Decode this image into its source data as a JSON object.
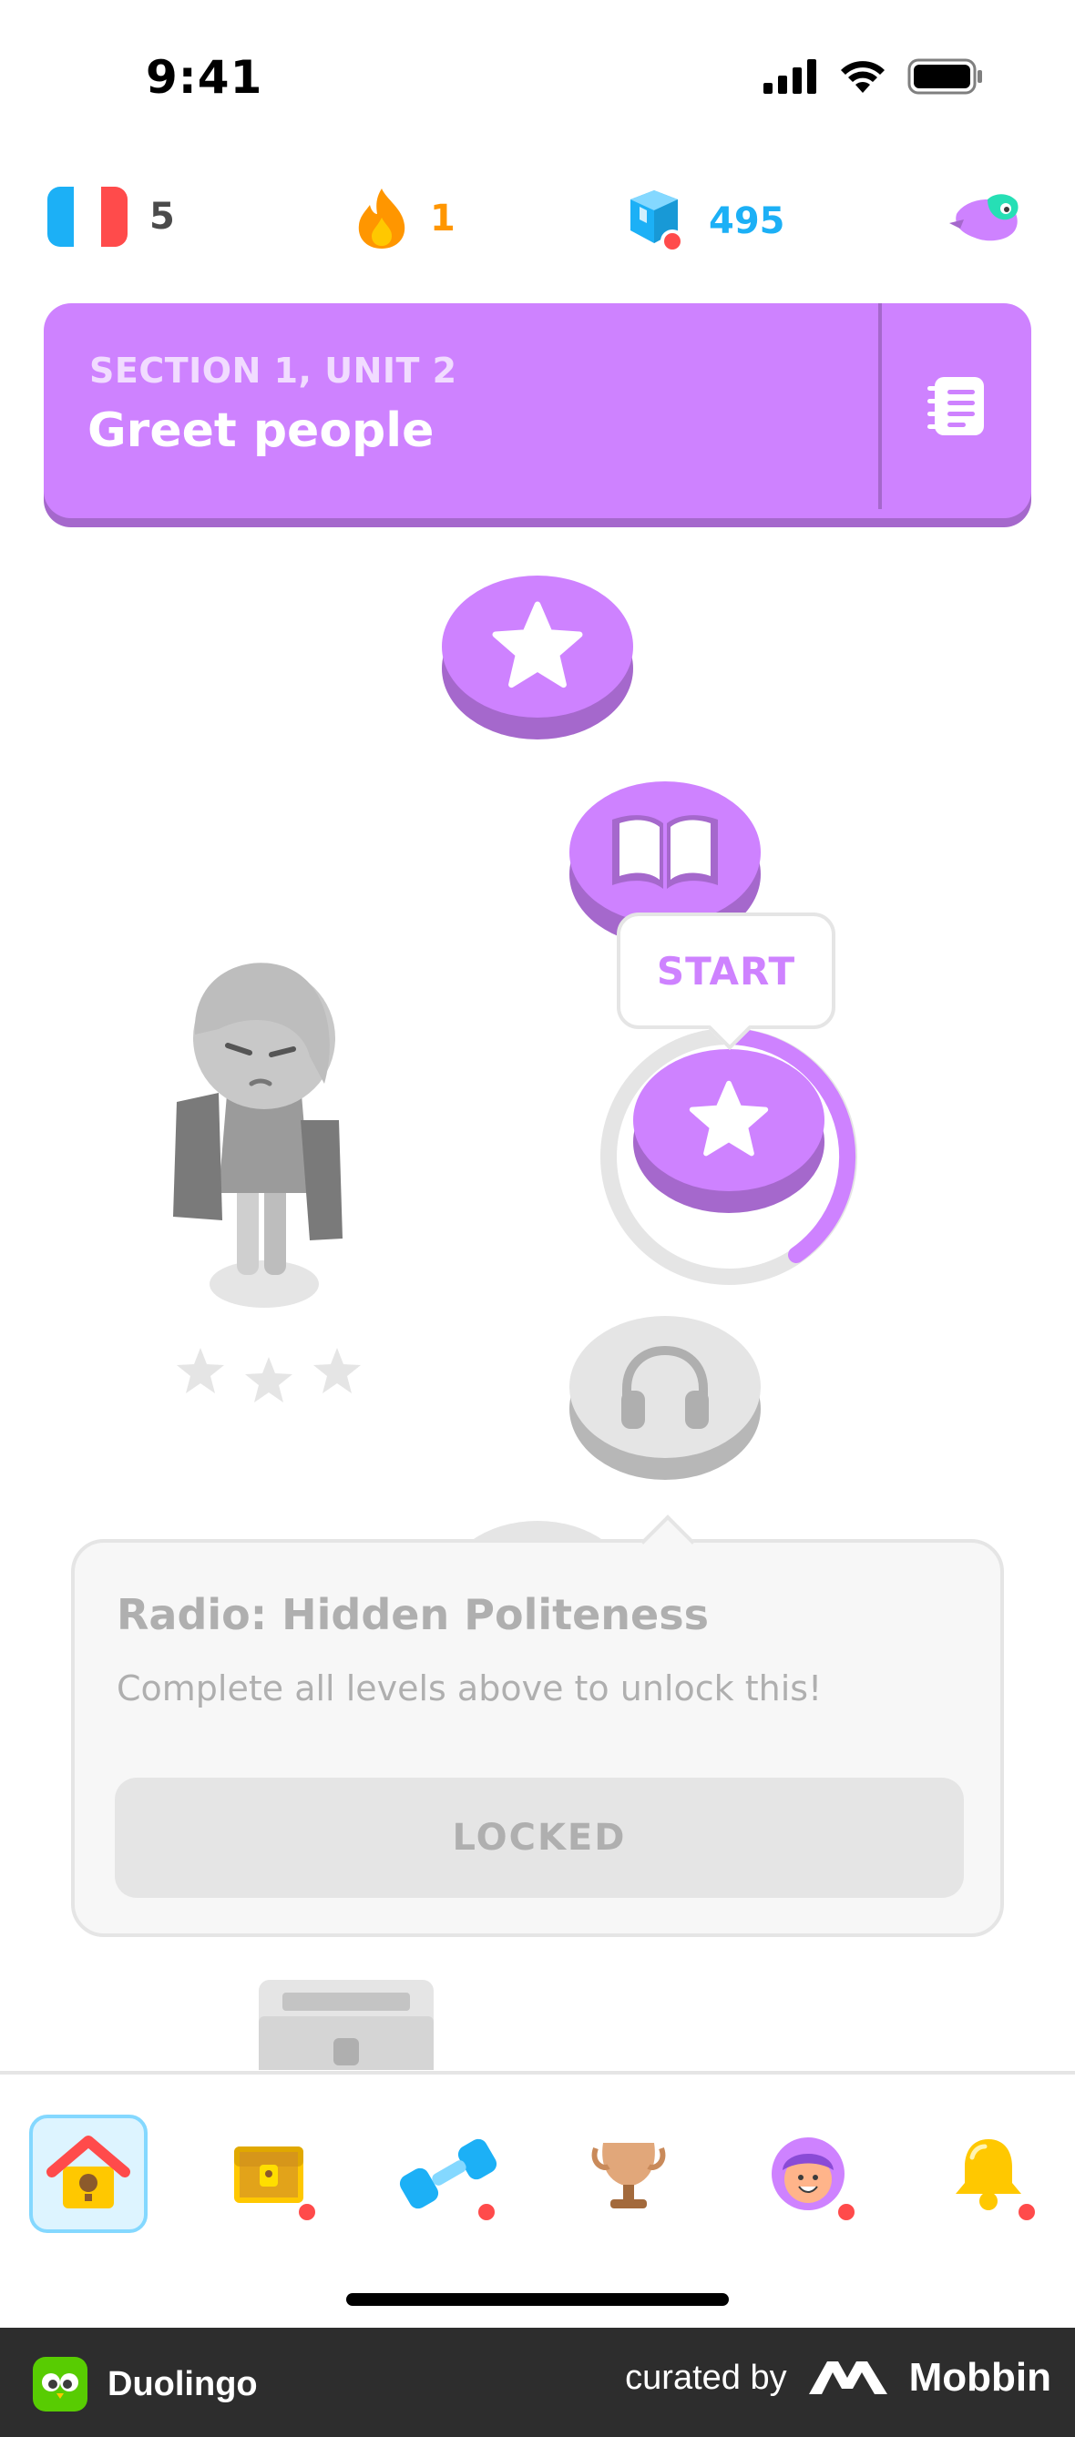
{
  "status_bar": {
    "time": "9:41"
  },
  "stats": {
    "course_flag": "france-flag",
    "courses_count": "5",
    "streak": "1",
    "gems": "495"
  },
  "unit": {
    "section": "SECTION 1, UNIT 2",
    "title": "Greet people"
  },
  "path": {
    "start_label": "START",
    "lessons": [
      {
        "icon": "star-icon",
        "state": "completed"
      },
      {
        "icon": "book-icon",
        "state": "completed"
      },
      {
        "icon": "star-icon",
        "state": "current"
      },
      {
        "icon": "headphones-icon",
        "state": "locked"
      }
    ]
  },
  "popup": {
    "title": "Radio: Hidden Politeness",
    "description": "Complete all levels above to unlock this!",
    "button": "LOCKED"
  },
  "nav": {
    "items": [
      {
        "name": "home-icon",
        "active": true,
        "badge": false
      },
      {
        "name": "chest-icon",
        "active": false,
        "badge": true
      },
      {
        "name": "dumbbell-icon",
        "active": false,
        "badge": true
      },
      {
        "name": "trophy-icon",
        "active": false,
        "badge": false
      },
      {
        "name": "profile-icon",
        "active": false,
        "badge": true
      },
      {
        "name": "bell-icon",
        "active": false,
        "badge": true
      }
    ]
  },
  "footer": {
    "app_name": "Duolingo",
    "curated_by": "curated by",
    "brand": "Mobbin"
  },
  "colors": {
    "purple": "#ce82ff",
    "purple_dark": "#a568cc",
    "orange": "#ff9600",
    "blue": "#1cb0f6",
    "grey": "#e5e5e5"
  }
}
